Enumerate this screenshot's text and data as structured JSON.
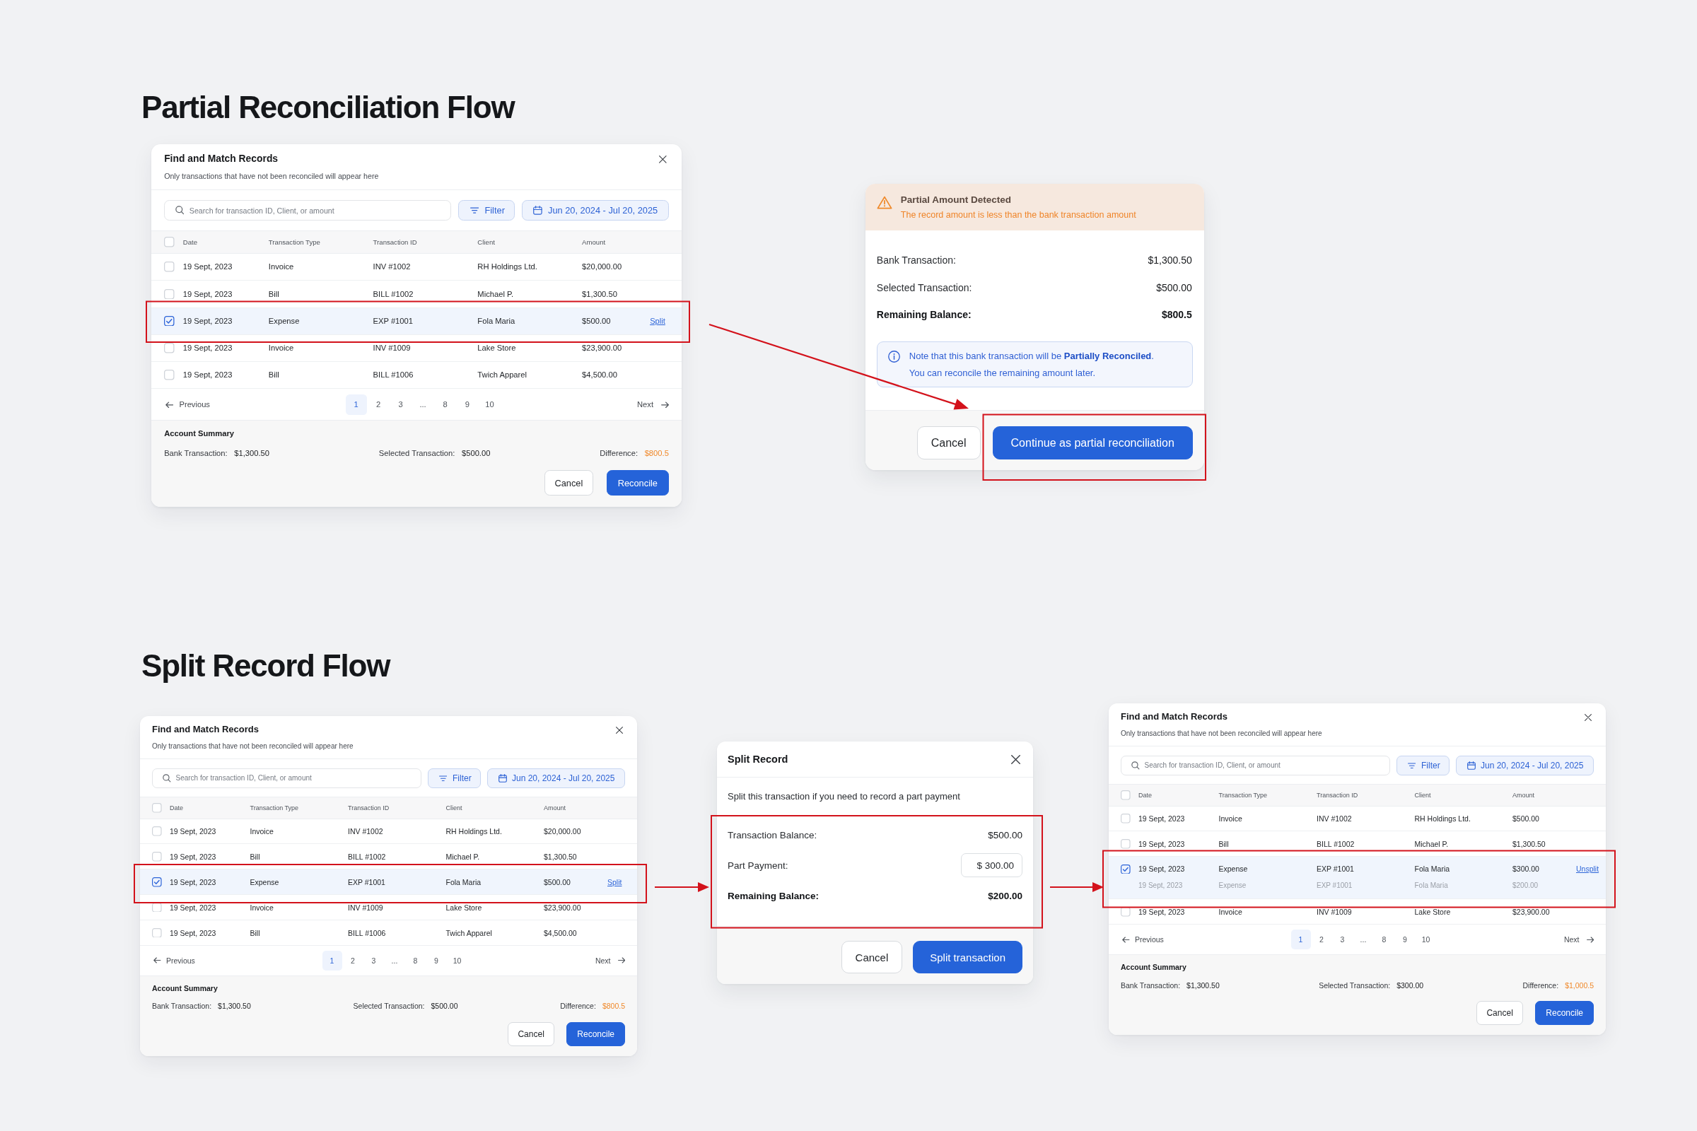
{
  "sections": [
    {
      "title": "Partial Reconciliation Flow",
      "screens": [
        {
          "kind": "find_match",
          "title": "Find and Match Records",
          "subtitle": "Only transactions that have not been reconciled will appear here",
          "search": {
            "placeholder": "Search for transaction ID, Client, or amount"
          },
          "filter": "Filter",
          "date_range": "Jun 20, 2024 - Jul 20, 2025",
          "table": {
            "all_checked": false,
            "columns": [
              "Date",
              "Transaction Type",
              "Transaction ID",
              "Client",
              "Amount"
            ],
            "rows": [
              {
                "date": "19 Sept, 2023",
                "transaction_type": "Invoice",
                "transaction_id": "INV #1002",
                "client": "RH Holdings Ltd.",
                "amount": "$20,000.00",
                "checked": false,
                "selected": false
              },
              {
                "date": "19 Sept, 2023",
                "transaction_type": "Bill",
                "transaction_id": "BILL #1002",
                "client": "Michael P.",
                "amount": "$1,300.50",
                "checked": false,
                "selected": false
              },
              {
                "date": "19 Sept, 2023",
                "transaction_type": "Expense",
                "transaction_id": "EXP #1001",
                "client": "Fola Maria",
                "amount": "$500.00",
                "checked": true,
                "selected": true,
                "action": "Split"
              },
              {
                "date": "19 Sept, 2023",
                "transaction_type": "Invoice",
                "transaction_id": "INV #1009",
                "client": "Lake Store",
                "amount": "$23,900.00",
                "checked": false,
                "selected": false
              },
              {
                "date": "19 Sept, 2023",
                "transaction_type": "Bill",
                "transaction_id": "BILL #1006",
                "client": "Twich Apparel",
                "amount": "$4,500.00",
                "checked": false,
                "selected": false
              }
            ]
          },
          "pagination": {
            "previous": "Previous",
            "pages": [
              {
                "label": "1",
                "selected": true
              },
              {
                "label": "2",
                "selected": false
              },
              {
                "label": "3",
                "selected": false
              },
              {
                "label": "...",
                "selected": false
              },
              {
                "label": "8",
                "selected": false
              },
              {
                "label": "9",
                "selected": false
              },
              {
                "label": "10",
                "selected": false
              }
            ],
            "next": "Next"
          },
          "summary": {
            "title": "Account Summary",
            "items": [
              {
                "label": "Bank Transaction:",
                "value": "$1,300.50",
                "kind": "plain"
              },
              {
                "label": "Selected Transaction:",
                "value": "$500.00",
                "kind": "plain"
              },
              {
                "label": "Difference:",
                "value": "$800.5",
                "kind": "warning"
              }
            ]
          },
          "buttons": [
            {
              "label": "Cancel",
              "kind": "cancel"
            },
            {
              "label": "Reconcile",
              "kind": "confirm"
            }
          ]
        },
        {
          "kind": "partial_alert",
          "alert": {
            "title": "Partial Amount Detected",
            "message": "The record amount is less than the bank transaction amount"
          },
          "details": [
            {
              "label": "Bank Transaction:",
              "value": "$1,300.50",
              "kind": "value"
            },
            {
              "label": "Selected Transaction:",
              "value": "$500.00",
              "kind": "value"
            },
            {
              "label": "Remaining Balance:",
              "value": "$800.5",
              "kind": "total"
            }
          ],
          "note": "Note that this bank transaction will be **Partially Reconciled**. You can reconcile the remaining amount later.",
          "buttons": [
            {
              "label": "Cancel",
              "kind": "cancel"
            },
            {
              "label": "Continue as partial reconciliation",
              "kind": "confirm"
            }
          ]
        }
      ]
    },
    {
      "title": "Split Record Flow",
      "screens": [
        {
          "kind": "find_match",
          "title": "Find and Match Records",
          "subtitle": "Only transactions that have not been reconciled will appear here",
          "search": {
            "placeholder": "Search for transaction ID, Client, or amount"
          },
          "filter": "Filter",
          "date_range": "Jun 20, 2024 - Jul 20, 2025",
          "table": {
            "all_checked": false,
            "columns": [
              "Date",
              "Transaction Type",
              "Transaction ID",
              "Client",
              "Amount"
            ],
            "rows": [
              {
                "date": "19 Sept, 2023",
                "transaction_type": "Invoice",
                "transaction_id": "INV #1002",
                "client": "RH Holdings Ltd.",
                "amount": "$20,000.00",
                "checked": false,
                "selected": false
              },
              {
                "date": "19 Sept, 2023",
                "transaction_type": "Bill",
                "transaction_id": "BILL #1002",
                "client": "Michael P.",
                "amount": "$1,300.50",
                "checked": false,
                "selected": false
              },
              {
                "date": "19 Sept, 2023",
                "transaction_type": "Expense",
                "transaction_id": "EXP #1001",
                "client": "Fola Maria",
                "amount": "$500.00",
                "checked": true,
                "selected": true,
                "action": "Split"
              },
              {
                "date": "19 Sept, 2023",
                "transaction_type": "Invoice",
                "transaction_id": "INV #1009",
                "client": "Lake Store",
                "amount": "$23,900.00",
                "checked": false,
                "selected": false
              },
              {
                "date": "19 Sept, 2023",
                "transaction_type": "Bill",
                "transaction_id": "BILL #1006",
                "client": "Twich Apparel",
                "amount": "$4,500.00",
                "checked": false,
                "selected": false
              }
            ]
          },
          "pagination": {
            "previous": "Previous",
            "pages": [
              {
                "label": "1",
                "selected": true
              },
              {
                "label": "2",
                "selected": false
              },
              {
                "label": "3",
                "selected": false
              },
              {
                "label": "...",
                "selected": false
              },
              {
                "label": "8",
                "selected": false
              },
              {
                "label": "9",
                "selected": false
              },
              {
                "label": "10",
                "selected": false
              }
            ],
            "next": "Next"
          },
          "summary": {
            "title": "Account Summary",
            "items": [
              {
                "label": "Bank Transaction:",
                "value": "$1,300.50",
                "kind": "plain"
              },
              {
                "label": "Selected Transaction:",
                "value": "$500.00",
                "kind": "plain"
              },
              {
                "label": "Difference:",
                "value": "$800.5",
                "kind": "warning"
              }
            ]
          },
          "buttons": [
            {
              "label": "Cancel",
              "kind": "cancel"
            },
            {
              "label": "Reconcile",
              "kind": "confirm"
            }
          ]
        },
        {
          "kind": "split_record",
          "title": "Split Record",
          "description": "Split this transaction if you need to record a part payment",
          "fields": [
            {
              "label": "Transaction Balance:",
              "value": "$500.00",
              "kind": "value"
            },
            {
              "label": "Part Payment:",
              "value": "$ 300.00",
              "kind": "input"
            },
            {
              "label": "Remaining Balance:",
              "value": "$200.00",
              "kind": "total"
            }
          ],
          "buttons": [
            {
              "label": "Cancel",
              "kind": "cancel"
            },
            {
              "label": "Split transaction",
              "kind": "confirm"
            }
          ]
        },
        {
          "kind": "find_match",
          "title": "Find and Match Records",
          "subtitle": "Only transactions that have not been reconciled will appear here",
          "search": {
            "placeholder": "Search for transaction ID, Client, or amount"
          },
          "filter": "Filter",
          "date_range": "Jun 20, 2024 - Jul 20, 2025",
          "table": {
            "all_checked": false,
            "columns": [
              "Date",
              "Transaction Type",
              "Transaction ID",
              "Client",
              "Amount"
            ],
            "rows": [
              {
                "date": "19 Sept, 2023",
                "transaction_type": "Invoice",
                "transaction_id": "INV #1002",
                "client": "RH Holdings Ltd.",
                "amount": "$500.00",
                "checked": false,
                "selected": false
              },
              {
                "date": "19 Sept, 2023",
                "transaction_type": "Bill",
                "transaction_id": "BILL #1002",
                "client": "Michael P.",
                "amount": "$1,300.50",
                "checked": false,
                "selected": false
              },
              {
                "date": "19 Sept, 2023",
                "transaction_type": "Expense",
                "transaction_id": "EXP #1001",
                "client": "Fola Maria",
                "amount": "$300.00",
                "checked": true,
                "selected": true,
                "action": "Unsplit",
                "split_parts": [
                  {
                    "date": "19 Sept, 2023",
                    "transaction_type": "Expense",
                    "transaction_id": "EXP #1001",
                    "client": "Fola Maria",
                    "amount": "$200.00"
                  }
                ]
              },
              {
                "date": "19 Sept, 2023",
                "transaction_type": "Invoice",
                "transaction_id": "INV #1009",
                "client": "Lake Store",
                "amount": "$23,900.00",
                "checked": false,
                "selected": false
              }
            ]
          },
          "pagination": {
            "previous": "Previous",
            "pages": [
              {
                "label": "1",
                "selected": true
              },
              {
                "label": "2",
                "selected": false
              },
              {
                "label": "3",
                "selected": false
              },
              {
                "label": "...",
                "selected": false
              },
              {
                "label": "8",
                "selected": false
              },
              {
                "label": "9",
                "selected": false
              },
              {
                "label": "10",
                "selected": false
              }
            ],
            "next": "Next"
          },
          "summary": {
            "title": "Account Summary",
            "items": [
              {
                "label": "Bank Transaction:",
                "value": "$1,300.50",
                "kind": "plain"
              },
              {
                "label": "Selected Transaction:",
                "value": "$300.00",
                "kind": "plain"
              },
              {
                "label": "Difference:",
                "value": "$1,000.5",
                "kind": "warning"
              }
            ]
          },
          "buttons": [
            {
              "label": "Cancel",
              "kind": "cancel"
            },
            {
              "label": "Reconcile",
              "kind": "confirm"
            }
          ]
        }
      ]
    }
  ]
}
